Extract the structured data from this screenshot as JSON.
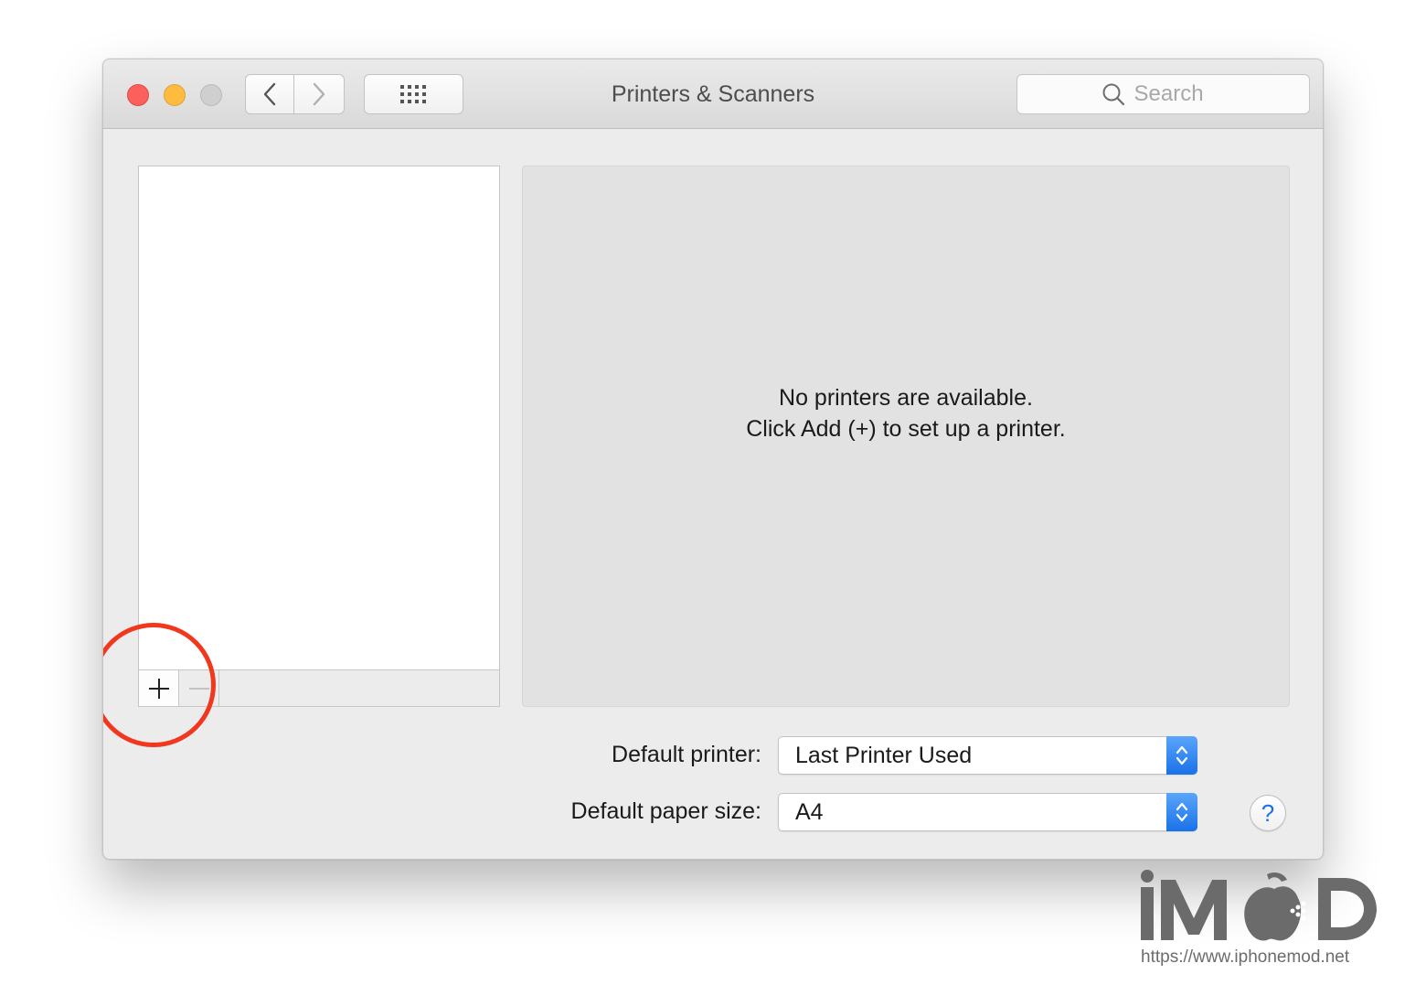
{
  "window": {
    "title": "Printers & Scanners"
  },
  "toolbar": {
    "back_icon": "chevron-left-icon",
    "forward_icon": "chevron-right-icon",
    "show_all_icon": "grid-icon"
  },
  "search": {
    "placeholder": "Search",
    "icon": "search-icon"
  },
  "printer_list": {
    "items": [],
    "add_icon": "plus-icon",
    "remove_icon": "minus-icon"
  },
  "detail": {
    "message_line1": "No printers are available.",
    "message_line2": "Click Add (+) to set up a printer."
  },
  "settings": {
    "default_printer_label": "Default printer:",
    "default_printer_value": "Last Printer Used",
    "default_paper_label": "Default paper size:",
    "default_paper_value": "A4"
  },
  "help": {
    "label": "?"
  },
  "watermark": {
    "url": "https://www.iphonemod.net"
  },
  "colors": {
    "accent_blue": "#1a72e8",
    "annotation_red": "#f2371f",
    "close": "#fc605c",
    "minimize": "#fdbc40",
    "zoom_disabled": "#cfcfcf"
  }
}
